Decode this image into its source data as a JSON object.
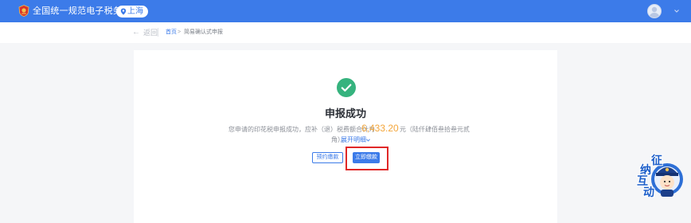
{
  "header": {
    "site_title": "全国统一规范电子税务局",
    "region": "上海",
    "brand_color": "#3c7be9",
    "icons": [
      "emblem-logo",
      "location-pin-icon",
      "user-avatar",
      "chevron-down-icon"
    ]
  },
  "breadcrumb": {
    "back_arrow": "←",
    "back_label": "返回",
    "home": "首页",
    "separator": ">",
    "current": "简易确认式申报"
  },
  "result": {
    "title": "申报成功",
    "message_prefix": "您申请的印花税申报成功，应补（退）税费额合计为",
    "amount": "6,433.20",
    "amount_color": "#f3a63b",
    "message_suffix": "元（陆仟肆佰叁拾叁元贰",
    "message_line2_prefix": "角）。",
    "expand_link": "展开明细",
    "success_color": "#36b37e"
  },
  "actions": {
    "schedule_label": "预约缴款",
    "pay_label": "立即缴款",
    "highlight_color": "#e02828"
  },
  "assistant": {
    "chars": [
      "征",
      "纳",
      "互",
      "动"
    ]
  }
}
